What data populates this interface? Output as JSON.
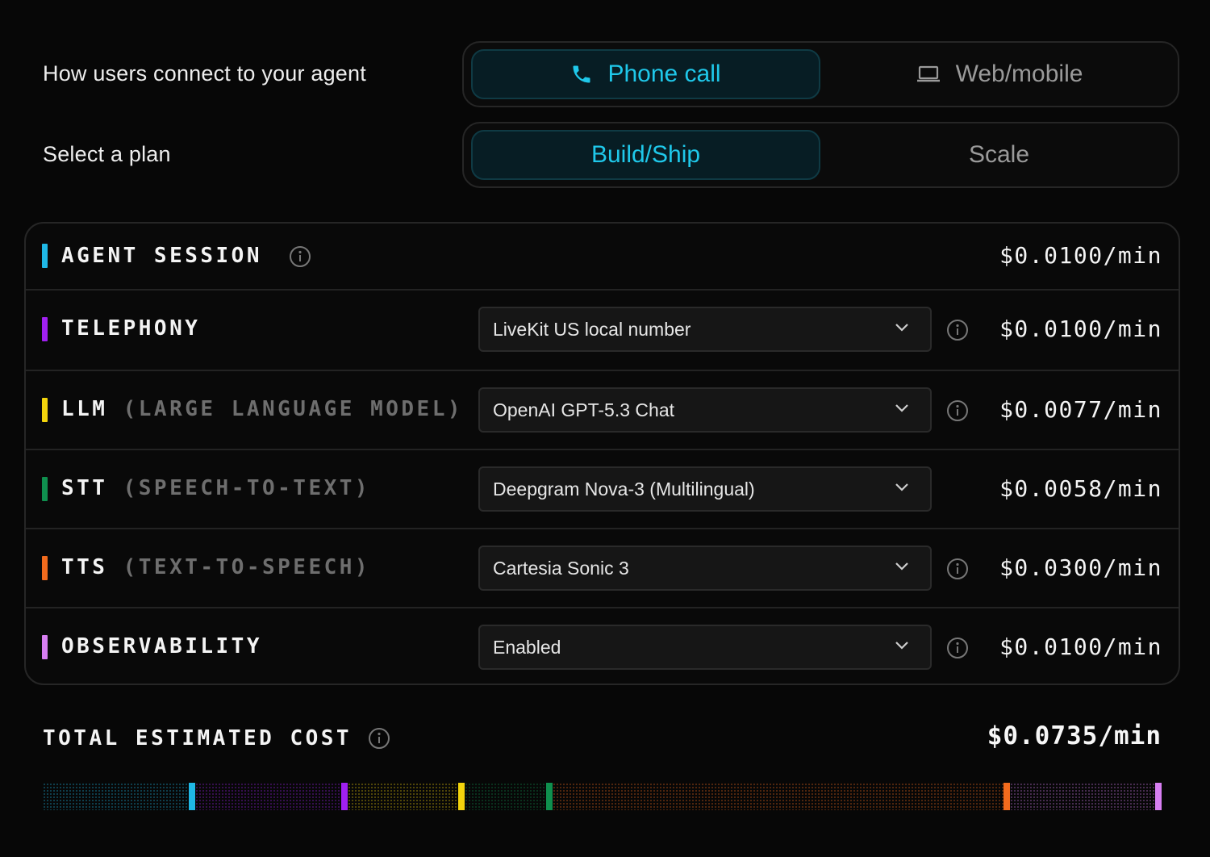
{
  "connect": {
    "label": "How users connect to your agent",
    "options": [
      {
        "label": "Phone call",
        "icon": "phone-icon",
        "active": true
      },
      {
        "label": "Web/mobile",
        "icon": "laptop-icon",
        "active": false
      }
    ]
  },
  "plan": {
    "label": "Select a plan",
    "options": [
      {
        "label": "Build/Ship",
        "active": true
      },
      {
        "label": "Scale",
        "active": false
      }
    ]
  },
  "rows": [
    {
      "label": "AGENT SESSION",
      "sub": "",
      "color": "#1fb8e6",
      "has_select": false,
      "select_value": "",
      "has_info": true,
      "price": "$0.0100/min",
      "share": 0.1361
    },
    {
      "label": "TELEPHONY",
      "sub": "",
      "color": "#a020f0",
      "has_select": true,
      "select_value": "LiveKit US local number",
      "has_info": true,
      "price": "$0.0100/min",
      "share": 0.1361
    },
    {
      "label": "LLM",
      "sub": "(LARGE LANGUAGE MODEL)",
      "color": "#f2d40c",
      "has_select": true,
      "select_value": "OpenAI GPT-5.3 Chat",
      "has_info": true,
      "price": "$0.0077/min",
      "share": 0.1048
    },
    {
      "label": "STT",
      "sub": "(SPEECH-TO-TEXT)",
      "color": "#0f8f4e",
      "has_select": true,
      "select_value": "Deepgram Nova-3 (Multilingual)",
      "has_info": false,
      "price": "$0.0058/min",
      "share": 0.0789
    },
    {
      "label": "TTS",
      "sub": "(TEXT-TO-SPEECH)",
      "color": "#f26b1d",
      "has_select": true,
      "select_value": "Cartesia Sonic 3",
      "has_info": true,
      "price": "$0.0300/min",
      "share": 0.4082
    },
    {
      "label": "OBSERVABILITY",
      "sub": "",
      "color": "#d77ef2",
      "has_select": true,
      "select_value": "Enabled",
      "has_info": true,
      "price": "$0.0100/min",
      "share": 0.1361
    }
  ],
  "total": {
    "label": "TOTAL ESTIMATED COST",
    "price": "$0.0735/min"
  }
}
